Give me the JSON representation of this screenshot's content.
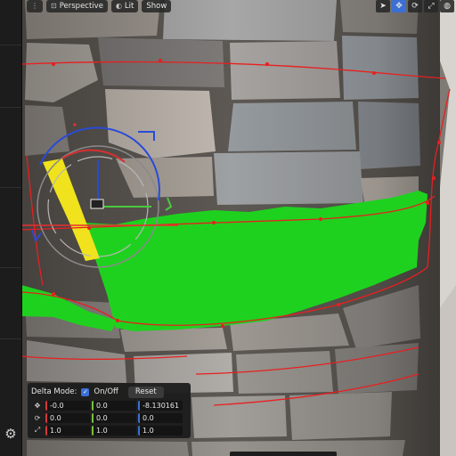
{
  "toolbar": {
    "menu_icon": "menu-dots-icon",
    "view_mode": "Perspective",
    "shading": "Lit",
    "show": "Show"
  },
  "gizmo_tools": {
    "items": [
      "select-arrow-icon",
      "move-icon",
      "rotate-icon",
      "scale-icon",
      "globe-icon"
    ],
    "active": "move-icon"
  },
  "delta_panel": {
    "mode_label": "Delta Mode:",
    "toggle_label": "On/Off",
    "toggle_checked": true,
    "reset_label": "Reset",
    "rows": [
      {
        "icon": "move-icon",
        "x": "-0.0",
        "y": "0.0",
        "z": "-8.130161"
      },
      {
        "icon": "rotate-icon",
        "x": "0.0",
        "y": "0.0",
        "z": "0.0"
      },
      {
        "icon": "scale-icon",
        "x": "1.0",
        "y": "1.0",
        "z": "1.0"
      }
    ]
  },
  "sidebar": {
    "settings_icon": "gear-icon"
  },
  "colors": {
    "selection": "#1fd11f",
    "highlight": "#f0e21c",
    "outline": "#e81f1f",
    "accent": "#3b6fd4",
    "axis_x": "#d23a3a",
    "axis_y": "#79c23a",
    "axis_z": "#3a70d2"
  }
}
